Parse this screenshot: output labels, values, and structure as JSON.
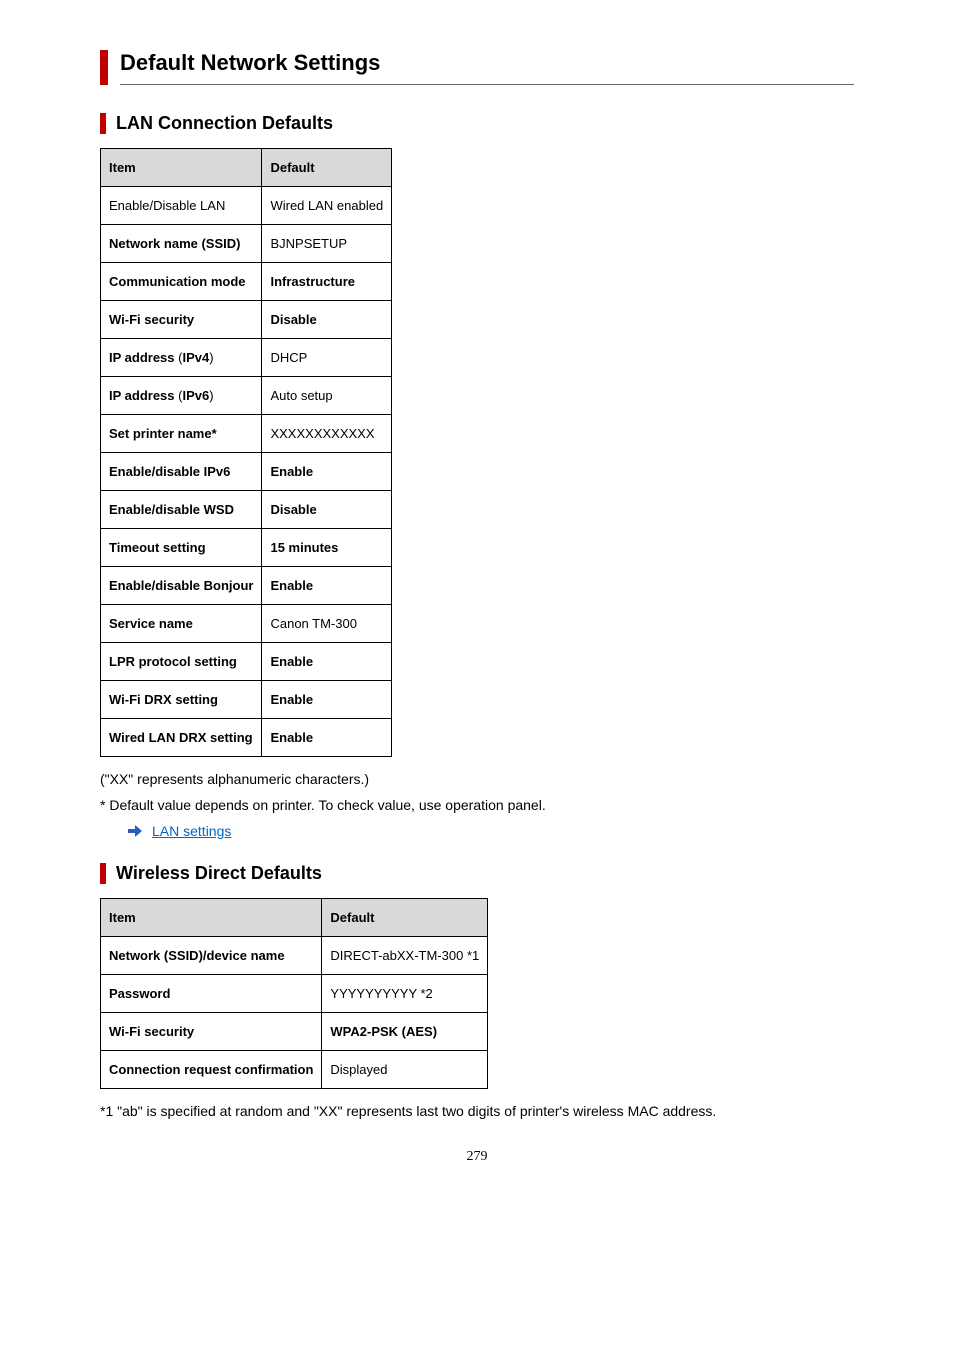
{
  "page_title": "Default Network Settings",
  "section1": {
    "title": "LAN Connection Defaults",
    "headers": {
      "item": "Item",
      "default": "Default"
    },
    "rows": [
      {
        "item": "Enable/Disable LAN",
        "default": "Wired LAN enabled",
        "item_bold": false,
        "default_bold": false
      },
      {
        "item": "Network name (SSID)",
        "default": "BJNPSETUP",
        "item_bold": true,
        "default_bold": false
      },
      {
        "item": "Communication mode",
        "default": "Infrastructure",
        "item_bold": true,
        "default_bold": true
      },
      {
        "item": "Wi-Fi security",
        "default": "Disable",
        "item_bold": true,
        "default_bold": true
      },
      {
        "item": "IP address (IPv4)",
        "default": "DHCP",
        "item_bold": true,
        "default_bold": false
      },
      {
        "item": "IP address (IPv6)",
        "default": "Auto setup",
        "item_bold": true,
        "default_bold": false
      },
      {
        "item": "Set printer name*",
        "default": "XXXXXXXXXXXX",
        "item_bold": true,
        "default_bold": false
      },
      {
        "item": "Enable/disable IPv6",
        "default": "Enable",
        "item_bold": true,
        "default_bold": true
      },
      {
        "item": "Enable/disable WSD",
        "default": "Disable",
        "item_bold": true,
        "default_bold": true
      },
      {
        "item": "Timeout setting",
        "default": "15 minutes",
        "item_bold": true,
        "default_bold": true
      },
      {
        "item": "Enable/disable Bonjour",
        "default": "Enable",
        "item_bold": true,
        "default_bold": true
      },
      {
        "item": "Service name",
        "default": "Canon TM-300",
        "item_bold": true,
        "default_bold": false
      },
      {
        "item": "LPR protocol setting",
        "default": "Enable",
        "item_bold": true,
        "default_bold": true
      },
      {
        "item": "Wi-Fi DRX setting",
        "default": "Enable",
        "item_bold": true,
        "default_bold": true
      },
      {
        "item": "Wired LAN DRX setting",
        "default": "Enable",
        "item_bold": true,
        "default_bold": true
      }
    ]
  },
  "note1": "(\"XX\" represents alphanumeric characters.)",
  "note2": "* Default value depends on printer. To check value, use operation panel.",
  "link_text": "LAN settings",
  "section2": {
    "title": "Wireless Direct Defaults",
    "headers": {
      "item": "Item",
      "default": "Default"
    },
    "rows": [
      {
        "item": "Network (SSID)/device name",
        "default": "DIRECT-abXX-TM-300 *1",
        "item_bold": true,
        "default_bold": false
      },
      {
        "item": "Password",
        "default": "YYYYYYYYYY *2",
        "item_bold": true,
        "default_bold": false
      },
      {
        "item": "Wi-Fi security",
        "default": "WPA2-PSK (AES)",
        "item_bold": true,
        "default_bold": true
      },
      {
        "item": "Connection request confirmation",
        "default": "Displayed",
        "item_bold": true,
        "default_bold": false
      }
    ]
  },
  "footnote": "*1 \"ab\" is specified at random and \"XX\" represents last two digits of printer's wireless MAC address.",
  "page_number": "279"
}
